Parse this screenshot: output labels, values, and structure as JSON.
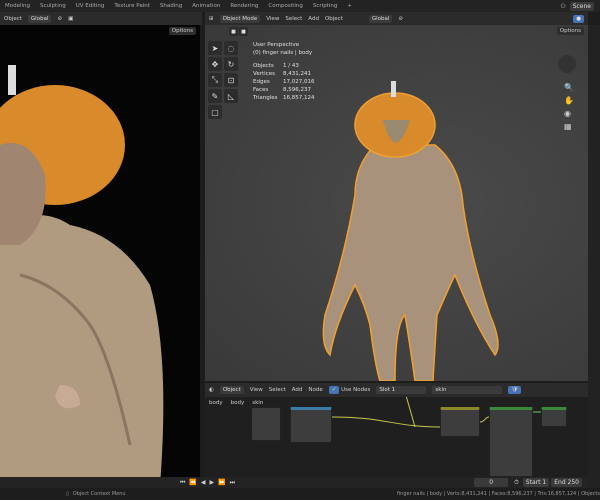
{
  "workspace_tabs": [
    "Modeling",
    "Sculpting",
    "UV Editing",
    "Texture Paint",
    "Shading",
    "Animation",
    "Rendering",
    "Compositing",
    "Scripting",
    "+"
  ],
  "scene": "Scene",
  "left_header": {
    "mode": "Object",
    "orientation": "Global",
    "options": "Options"
  },
  "right_header": {
    "mode": "Object Mode",
    "menus": [
      "View",
      "Select",
      "Add",
      "Object"
    ],
    "orientation": "Global",
    "options": "Options"
  },
  "viewport": {
    "title": "User Perspective",
    "subtitle": "(0) finger nails | body",
    "stats": [
      {
        "label": "Objects",
        "value": "1 / 43"
      },
      {
        "label": "Vertices",
        "value": "8,431,241"
      },
      {
        "label": "Edges",
        "value": "17,027,016"
      },
      {
        "label": "Faces",
        "value": "8,596,237"
      },
      {
        "label": "Triangles",
        "value": "16,857,124"
      }
    ]
  },
  "node_editor": {
    "type": "Object",
    "menus": [
      "View",
      "Select",
      "Add",
      "Node"
    ],
    "use_nodes": "Use Nodes",
    "slot": "Slot 1",
    "material": "skin",
    "breadcrumb": [
      "body",
      "body",
      "skin"
    ]
  },
  "timeline": {
    "frame": "0",
    "start_label": "Start",
    "start": "1",
    "end_label": "End",
    "end": "250"
  },
  "status": {
    "left": "Object Context Menu",
    "right": "finger nails | body | Verts:8,431,241 | Faces:8,596,237 | Tris:16,857,124 | Objects"
  },
  "colors": {
    "accent": "#4772b3",
    "pumpkin": "#d98a2a",
    "selection": "#f0a030"
  }
}
